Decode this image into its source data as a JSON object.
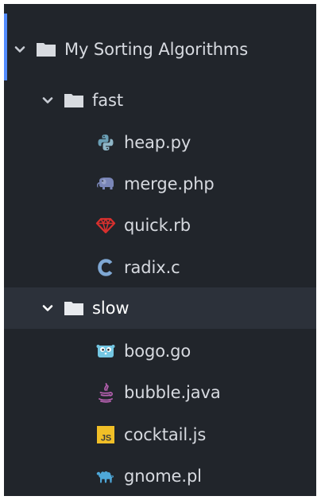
{
  "window": {
    "title": "My Sorting Algorithms"
  },
  "tree": {
    "root": {
      "label": "My Sorting Algorithms",
      "icon": "folder-icon",
      "expanded": true
    },
    "folders": [
      {
        "label": "fast",
        "icon": "folder-icon",
        "expanded": true,
        "files": [
          {
            "label": "heap.py",
            "icon": "python-icon"
          },
          {
            "label": "merge.php",
            "icon": "php-elephant-icon"
          },
          {
            "label": "quick.rb",
            "icon": "ruby-icon"
          },
          {
            "label": "radix.c",
            "icon": "c-icon"
          }
        ]
      },
      {
        "label": "slow",
        "icon": "folder-icon",
        "expanded": true,
        "selected": true,
        "files": [
          {
            "label": "bogo.go",
            "icon": "go-gopher-icon"
          },
          {
            "label": "bubble.java",
            "icon": "java-icon"
          },
          {
            "label": "cocktail.js",
            "icon": "javascript-icon",
            "badge": "JS"
          },
          {
            "label": "gnome.pl",
            "icon": "perl-camel-icon"
          }
        ]
      }
    ]
  },
  "colors": {
    "background": "#21252b",
    "text": "#d7dae0",
    "selected_row": "#2c313a",
    "active_bar": "#528bff",
    "python": "#6a9fb5",
    "php": "#7a86b8",
    "ruby": "#d9302e",
    "c": "#7fa8d4",
    "go": "#74c7e3",
    "java": "#b35fae",
    "javascript": "#f1bf27",
    "perl": "#4ea7d8"
  }
}
